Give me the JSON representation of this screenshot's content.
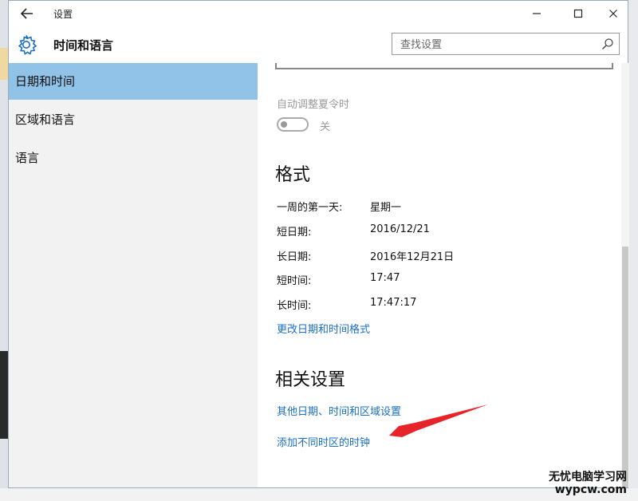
{
  "window": {
    "title": "设置"
  },
  "header": {
    "section_title": "时间和语言"
  },
  "search": {
    "placeholder": "查找设置"
  },
  "sidebar": {
    "items": [
      {
        "label": "日期和时间",
        "active": true
      },
      {
        "label": "区域和语言",
        "active": false
      },
      {
        "label": "语言",
        "active": false
      }
    ]
  },
  "dst": {
    "label": "自动调整夏令时",
    "state": "关",
    "on": false
  },
  "format": {
    "heading": "格式",
    "rows": [
      {
        "key": "一周的第一天:",
        "value": "星期一"
      },
      {
        "key": "短日期:",
        "value": "2016/12/21"
      },
      {
        "key": "长日期:",
        "value": "2016年12月21日"
      },
      {
        "key": "短时间:",
        "value": "17:47"
      },
      {
        "key": "长时间:",
        "value": "17:47:17"
      }
    ],
    "change_link": "更改日期和时间格式"
  },
  "related": {
    "heading": "相关设置",
    "links": [
      "其他日期、时间和区域设置",
      "添加不同时区的时钟"
    ]
  },
  "colors": {
    "accent_active": "#91c2e8",
    "link": "#1a6fc4",
    "annotation_arrow": "#e8242b"
  },
  "watermark": {
    "line1": "无忧电脑学习网",
    "line2": "wypcw.com"
  }
}
